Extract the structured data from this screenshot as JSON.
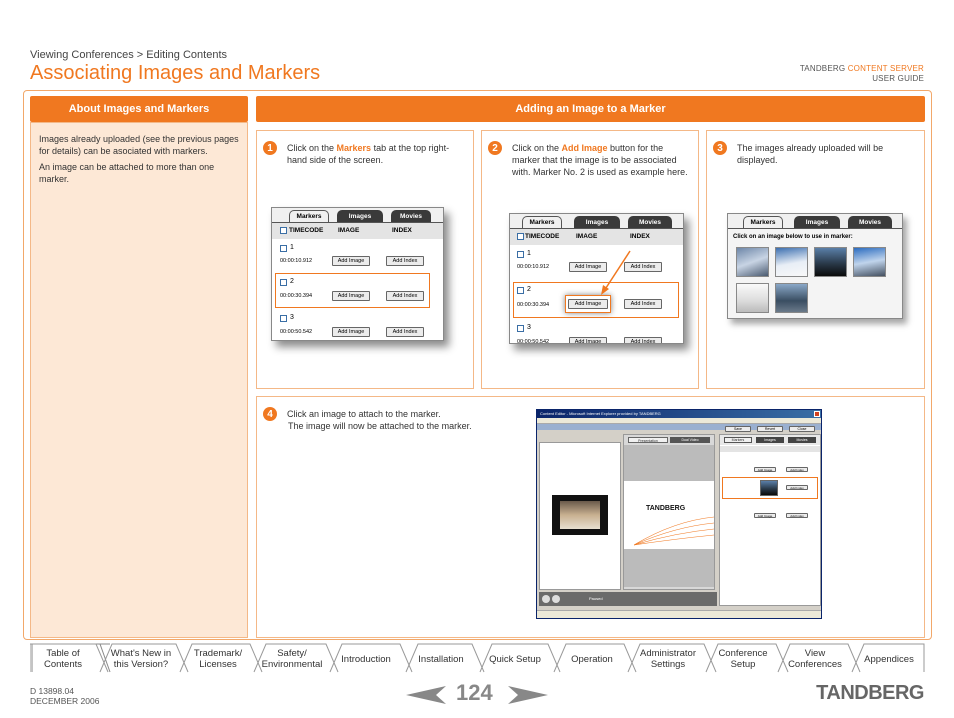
{
  "header": {
    "breadcrumb": "Viewing Conferences > Editing Contents",
    "title": "Associating Images and Markers",
    "brand_prefix": "TANDBERG ",
    "brand_accent": "CONTENT SERVER",
    "brand_sub": "USER GUIDE"
  },
  "colors": {
    "accent": "#f07820",
    "panel": "#fde8d6"
  },
  "left_panel": {
    "heading": "About Images and Markers",
    "para1": "Images already uploaded (see the previous pages for details) can be asociated with markers.",
    "para2": "An image can be attached to more than one marker."
  },
  "right_heading": "Adding an Image to a Marker",
  "steps": {
    "s1": {
      "num": "1",
      "pre": "Click on the ",
      "hl": "Markers",
      "post": " tab at the top right-hand side of the screen."
    },
    "s2": {
      "num": "2",
      "pre": "Click on the ",
      "hl": "Add Image",
      "post": " button for the marker that the image is to be associated with. Marker No. 2 is used as example here."
    },
    "s3": {
      "num": "3",
      "text": "The images already uploaded will be displayed."
    },
    "s4": {
      "num": "4",
      "line1": "Click an image to attach to the marker.",
      "line2": "The image will now be attached to the marker."
    }
  },
  "mock": {
    "tab_markers": "Markers",
    "tab_images": "Images",
    "tab_movies": "Movies",
    "col_timecode": "TIMECODE",
    "col_image": "IMAGE",
    "col_index": "INDEX",
    "rows": [
      {
        "num": "1",
        "time": "00:00:10.912"
      },
      {
        "num": "2",
        "time": "00:00:30.394"
      },
      {
        "num": "3",
        "time": "00:00:50.542"
      }
    ],
    "btn_add_image": "Add Image",
    "btn_add_index": "Add Index",
    "images_prompt": "Click on an image below to use in marker:"
  },
  "browser": {
    "title": "Content Editor - Microsoft Internet Explorer provided by TANDBERG",
    "tab_presentation": "Presentation",
    "tab_dual_video": "Dual Video",
    "logo": "TANDBERG",
    "btn_save": "Save",
    "btn_revert": "Revert",
    "btn_close": "Close",
    "status_paused": "Paused"
  },
  "nav": [
    {
      "l1": "Table of",
      "l2": "Contents"
    },
    {
      "l1": "What's New in",
      "l2": "this Version?"
    },
    {
      "l1": "Trademark/",
      "l2": "Licenses"
    },
    {
      "l1": "Safety/",
      "l2": "Environmental"
    },
    {
      "l1": "Introduction",
      "l2": ""
    },
    {
      "l1": "Installation",
      "l2": ""
    },
    {
      "l1": "Quick Setup",
      "l2": ""
    },
    {
      "l1": "Operation",
      "l2": ""
    },
    {
      "l1": "Administrator",
      "l2": "Settings"
    },
    {
      "l1": "Conference",
      "l2": "Setup"
    },
    {
      "l1": "View",
      "l2": "Conferences"
    },
    {
      "l1": "Appendices",
      "l2": ""
    }
  ],
  "footer": {
    "doc_id": "D 13898.04",
    "date": "DECEMBER 2006",
    "page": "124",
    "logo": "TANDBERG"
  }
}
